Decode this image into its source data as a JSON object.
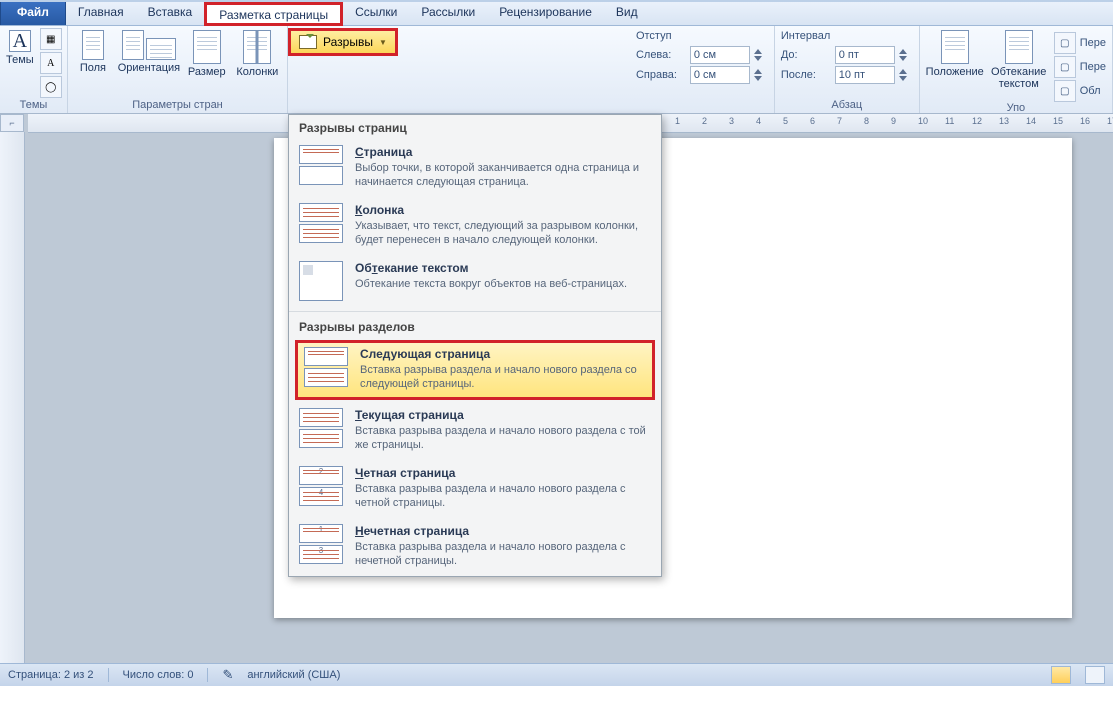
{
  "tabs": {
    "file": "Файл",
    "home": "Главная",
    "insert": "Вставка",
    "layout": "Разметка страницы",
    "references": "Ссылки",
    "mailings": "Рассылки",
    "review": "Рецензирование",
    "view": "Вид"
  },
  "ribbon": {
    "themes": {
      "label": "Темы",
      "group": "Темы"
    },
    "margins": "Поля",
    "orientation": "Ориентация",
    "size": "Размер",
    "columns": "Колонки",
    "breaks": "Разрывы",
    "page_setup_group": "Параметры стран",
    "indent": {
      "group": "Отступ",
      "left_label": "Слева:",
      "right_label": "Справа:",
      "left_value": "0 см",
      "right_value": "0 см"
    },
    "spacing": {
      "group": "Интервал",
      "before_label": "До:",
      "after_label": "После:",
      "before_value": "0 пт",
      "after_value": "10 пт"
    },
    "paragraph_group": "Абзац",
    "position": "Положение",
    "wrap": "Обтекание текстом",
    "arrange_group": "Упо",
    "bring_forward": "Пере",
    "send_backward": "Пере",
    "selection_pane": "Обл"
  },
  "breaks_menu": {
    "page_breaks_header": "Разрывы страниц",
    "page": {
      "title_pre": "",
      "title_u": "С",
      "title_post": "траница",
      "desc": "Выбор точки, в которой заканчивается одна страница и начинается следующая страница."
    },
    "column": {
      "title_pre": "",
      "title_u": "К",
      "title_post": "олонка",
      "desc": "Указывает, что текст, следующий за разрывом колонки, будет перенесен в начало следующей колонки."
    },
    "textwrap": {
      "title_pre": "Об",
      "title_u": "т",
      "title_post": "екание текстом",
      "desc": "Обтекание текста вокруг объектов на веб-страницах."
    },
    "section_breaks_header": "Разрывы разделов",
    "next_page": {
      "title": "Следующая страница",
      "desc": "Вставка разрыва раздела и начало нового раздела со следующей страницы."
    },
    "continuous": {
      "title_pre": "",
      "title_u": "Т",
      "title_post": "екущая страница",
      "desc": "Вставка разрыва раздела и начало нового раздела с той же страницы."
    },
    "even": {
      "title_pre": "",
      "title_u": "Ч",
      "title_post": "етная страница",
      "desc": "Вставка разрыва раздела и начало нового раздела с четной страницы."
    },
    "odd": {
      "title_pre": "",
      "title_u": "Н",
      "title_post": "ечетная страница",
      "desc": "Вставка разрыва раздела и начало нового раздела с нечетной страницы."
    }
  },
  "status": {
    "page": "Страница: 2 из 2",
    "words": "Число слов: 0",
    "lang": "английский (США)"
  }
}
